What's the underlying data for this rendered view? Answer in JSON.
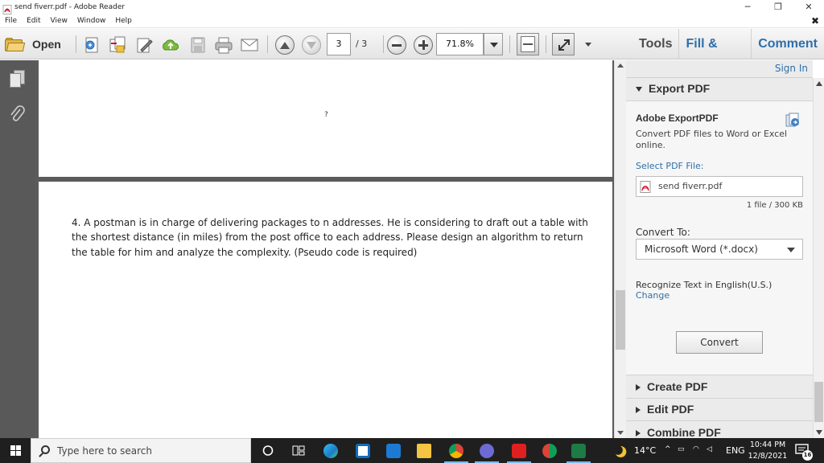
{
  "window": {
    "title": "send fiverr.pdf - Adobe Reader",
    "minimize": "─",
    "restore": "❐",
    "close": "✕"
  },
  "menu": {
    "items": [
      "File",
      "Edit",
      "View",
      "Window",
      "Help"
    ],
    "close_doc": "✖"
  },
  "toolbar": {
    "open_label": "Open",
    "page_current": "3",
    "page_total": "/ 3",
    "zoom": "71.8%"
  },
  "right_tabs": {
    "tools": "Tools",
    "fill_sign": "Fill & Sign",
    "comment": "Comment"
  },
  "document": {
    "page1_mark": "?",
    "question": "4. A postman is in charge of delivering packages to n addresses. He is considering to draft out a table with the shortest distance (in miles) from the post office to each address. Please design an algorithm to return the table for him and analyze the complexity. (Pseudo code is required)"
  },
  "panel": {
    "sign_in": "Sign In",
    "export_header": "Export PDF",
    "export_title": "Adobe ExportPDF",
    "export_desc": "Convert PDF files to Word or Excel online.",
    "select_label": "Select PDF File:",
    "file_name": "send fiverr.pdf",
    "file_count": "1 file / 300 KB",
    "convert_to_label": "Convert To:",
    "format_selected": "Microsoft Word (*.docx)",
    "recognize_text": "Recognize Text in English(U.S.)",
    "change_link": "Change",
    "convert_button": "Convert",
    "create_header": "Create PDF",
    "edit_header": "Edit PDF",
    "combine_header": "Combine PDF"
  },
  "taskbar": {
    "search_placeholder": "Type here to search",
    "temperature": "14°C",
    "language": "ENG",
    "time": "10:44 PM",
    "date": "12/8/2021",
    "notification_count": "16"
  },
  "colors": {
    "accent_link": "#2f6fa9",
    "panel_bg": "#ebebeb",
    "doc_bg": "#5b5b5b",
    "taskbar_bg": "#1f1f1f"
  }
}
